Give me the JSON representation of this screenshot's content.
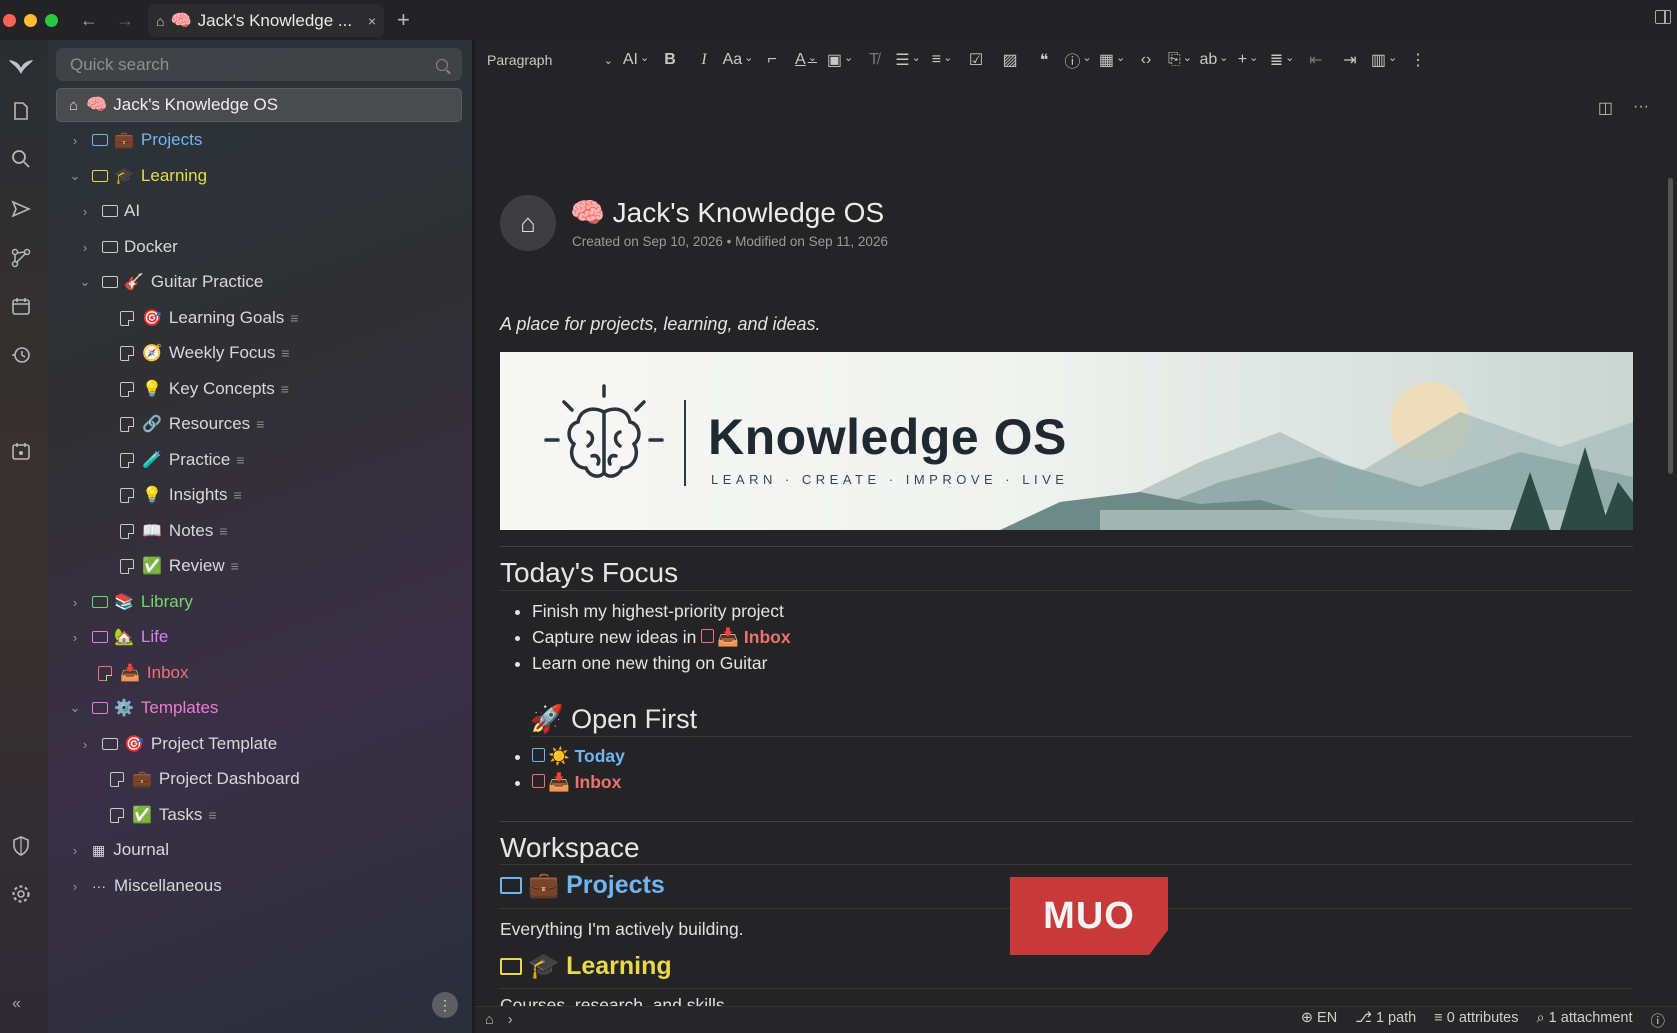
{
  "titlebar": {
    "tab_title": "Jack's Knowledge ...",
    "tab_emoji": "🧠",
    "close_glyph": "×",
    "new_tab_glyph": "+",
    "back_glyph": "←",
    "forward_glyph": "→"
  },
  "launcher": {
    "icons": [
      "app-logo-icon",
      "new-note-icon",
      "search-icon",
      "send-icon",
      "graph-icon",
      "calendar-icon",
      "history-icon",
      "calendar-star-icon",
      "shield-icon",
      "settings-icon",
      "collapse-icon"
    ]
  },
  "sidebar": {
    "search_placeholder": "Quick search",
    "root": {
      "emoji": "🧠",
      "label": "Jack's Knowledge OS"
    },
    "items": [
      {
        "emoji": "💼",
        "label": "Projects"
      },
      {
        "emoji": "🎓",
        "label": "Learning"
      },
      {
        "emoji": "",
        "label": "AI"
      },
      {
        "emoji": "",
        "label": "Docker"
      },
      {
        "emoji": "🎸",
        "label": "Guitar Practice"
      },
      {
        "emoji": "🎯",
        "label": "Learning Goals"
      },
      {
        "emoji": "🧭",
        "label": "Weekly Focus"
      },
      {
        "emoji": "💡",
        "label": "Key Concepts"
      },
      {
        "emoji": "🔗",
        "label": "Resources"
      },
      {
        "emoji": "🧪",
        "label": "Practice"
      },
      {
        "emoji": "💡",
        "label": "Insights"
      },
      {
        "emoji": "📖",
        "label": "Notes"
      },
      {
        "emoji": "✅",
        "label": "Review"
      },
      {
        "emoji": "📚",
        "label": "Library"
      },
      {
        "emoji": "🏡",
        "label": "Life"
      },
      {
        "emoji": "📥",
        "label": "Inbox"
      },
      {
        "emoji": "⚙️",
        "label": "Templates"
      },
      {
        "emoji": "🎯",
        "label": "Project Template"
      },
      {
        "emoji": "💼",
        "label": "Project Dashboard"
      },
      {
        "emoji": "✅",
        "label": "Tasks"
      },
      {
        "emoji": "",
        "label": "Journal"
      },
      {
        "emoji": "",
        "label": "Miscellaneous"
      }
    ]
  },
  "toolbar": {
    "block_type": "Paragraph"
  },
  "note": {
    "title_emoji": "🧠",
    "title": "Jack's Knowledge OS",
    "meta": "Created on Sep 10, 2026 • Modified on Sep 11, 2026",
    "tagline": "A place for projects, learning, and ideas.",
    "banner": {
      "title": "Knowledge OS",
      "subtitle": "LEARN · CREATE · IMPROVE · LIVE"
    },
    "focus": {
      "heading": "Today's Focus",
      "item1": "Finish my highest-priority project",
      "item2_prefix": "Capture new ideas in",
      "item2_link": "📥 Inbox",
      "item3": "Learn one new thing on Guitar"
    },
    "open_first": {
      "heading": "🚀 Open First",
      "link1": "☀️ Today",
      "link2": "📥 Inbox"
    },
    "workspace": {
      "heading": "Workspace",
      "projects_label": "💼 Projects",
      "projects_desc": "Everything I'm actively building.",
      "learning_label": "🎓 Learning",
      "learning_desc": "Courses, research, and skills."
    }
  },
  "watermark": "MUO",
  "statusbar": {
    "lang": "EN",
    "paths": "1 path",
    "attributes": "0 attributes",
    "attachments": "1 attachment"
  },
  "colors": {
    "projects": "#74b4f0",
    "learning": "#e8d94a",
    "library": "#73d86a",
    "life": "#d483f0",
    "inbox": "#f0707a",
    "templates": "#f07ad0"
  }
}
